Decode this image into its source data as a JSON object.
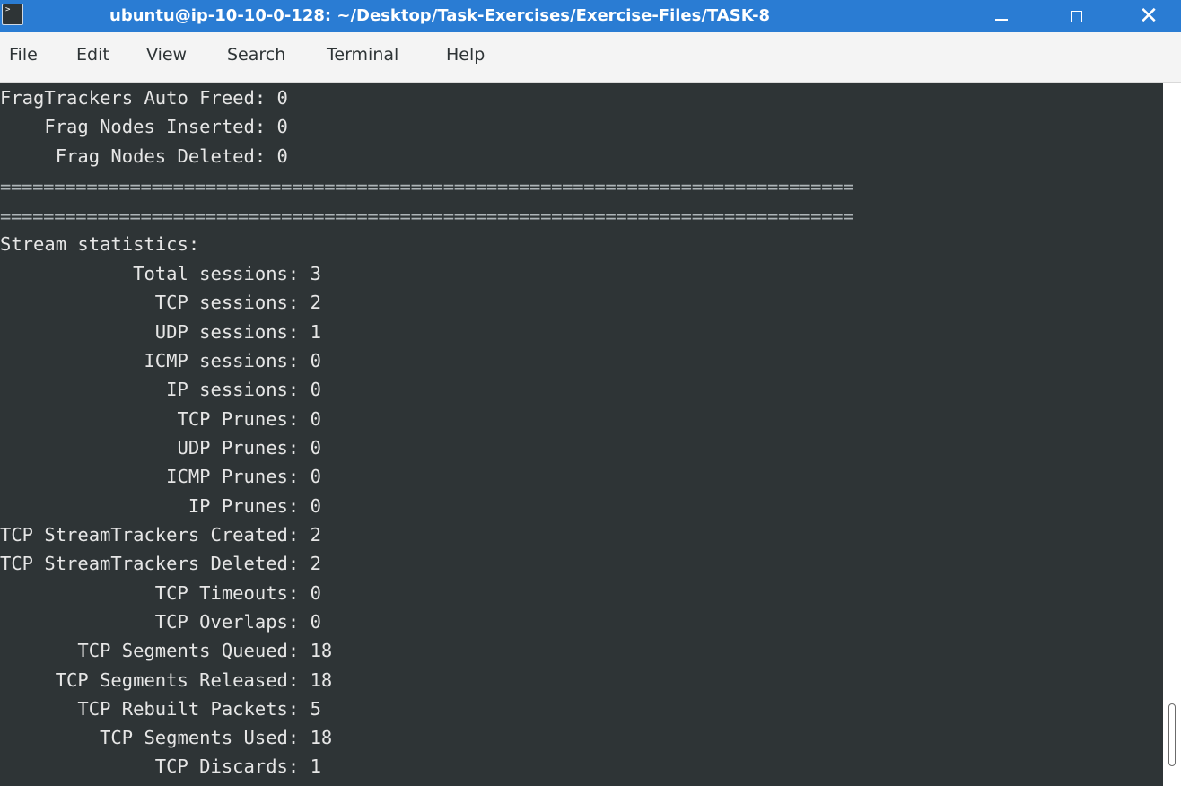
{
  "window": {
    "title": "ubuntu@ip-10-10-0-128: ~/Desktop/Task-Exercises/Exercise-Files/TASK-8",
    "app_icon_text": ">_",
    "minimize_label": "",
    "maximize_label": "",
    "close_label": "✕"
  },
  "menu": [
    "File",
    "Edit",
    "View",
    "Search",
    "Terminal",
    "Help"
  ],
  "terminal": {
    "lines": [
      "FragTrackers Auto Freed: 0",
      "    Frag Nodes Inserted: 0",
      "     Frag Nodes Deleted: 0",
      "===============================================================================",
      "===============================================================================",
      "Stream statistics:",
      "            Total sessions: 3",
      "              TCP sessions: 2",
      "              UDP sessions: 1",
      "             ICMP sessions: 0",
      "               IP sessions: 0",
      "                TCP Prunes: 0",
      "                UDP Prunes: 0",
      "               ICMP Prunes: 0",
      "                 IP Prunes: 0",
      "TCP StreamTrackers Created: 2",
      "TCP StreamTrackers Deleted: 2",
      "              TCP Timeouts: 0",
      "              TCP Overlaps: 0",
      "       TCP Segments Queued: 18",
      "     TCP Segments Released: 18",
      "       TCP Rebuilt Packets: 5",
      "         TCP Segments Used: 18",
      "              TCP Discards: 1"
    ]
  },
  "colors": {
    "titlebar": "#2a7cd3",
    "terminal_bg": "#2e3436",
    "terminal_fg": "#e6e6e6",
    "menubar_bg": "#f4f4f4"
  }
}
